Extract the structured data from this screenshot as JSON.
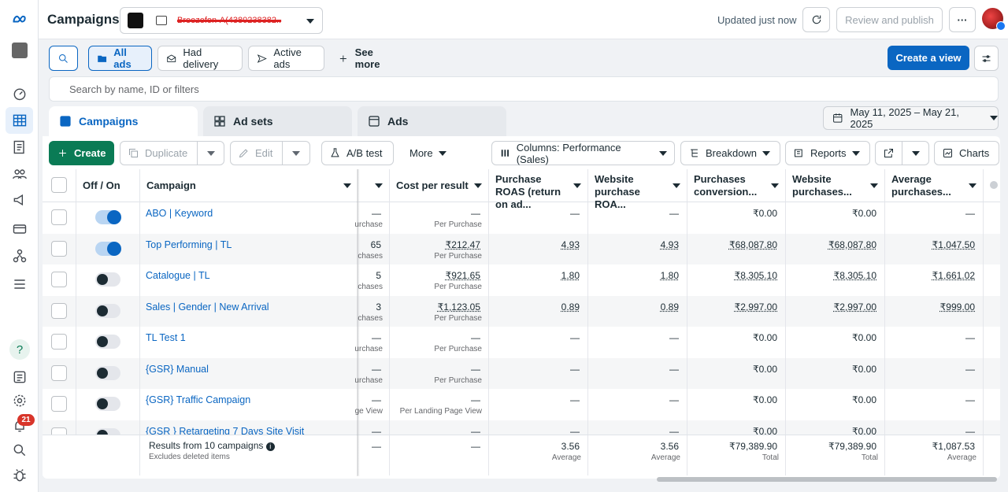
{
  "topbar": {
    "title": "Campaigns",
    "account_name": "Breezefon-A(4380238382..",
    "updated": "Updated just now",
    "review_publish": "Review and publish",
    "more": "···"
  },
  "nav": {
    "notifications_count": "21"
  },
  "filters": {
    "all_ads": "All ads",
    "had_delivery": "Had delivery",
    "active_ads": "Active ads",
    "see_more": "See more",
    "create_view": "Create a view",
    "search_placeholder": "Search by name, ID or filters"
  },
  "tabs": {
    "campaigns": "Campaigns",
    "ad_sets": "Ad sets",
    "ads": "Ads"
  },
  "date_range": "May 11, 2025 – May 21, 2025",
  "actions": {
    "create": "Create",
    "duplicate": "Duplicate",
    "edit": "Edit",
    "ab_test": "A/B test",
    "more": "More",
    "columns": "Columns: Performance (Sales)",
    "breakdown": "Breakdown",
    "reports": "Reports",
    "charts": "Charts"
  },
  "columns": {
    "offon": "Off / On",
    "campaign": "Campaign",
    "cost_per_result": "Cost per result",
    "purchase_roas": "Purchase ROAS (return on ad...",
    "website_roas": "Website purchase ROA...",
    "purchases_conv": "Purchases conversion...",
    "website_purchases": "Website purchases...",
    "average_purchases": "Average purchases..."
  },
  "rows": [
    {
      "name": "ABO | Keyword",
      "on": true,
      "results": "—",
      "results_sub": "urchase",
      "cpr": "—",
      "cpr_sub": "Per Purchase",
      "roas": "—",
      "wroas": "—",
      "pconv": "₹0.00",
      "wpur": "₹0.00",
      "avg": "—"
    },
    {
      "name": "Top Performing | TL",
      "on": true,
      "results": "65",
      "results_sub": "chases",
      "cpr": "₹212.47",
      "cpr_sub": "Per Purchase",
      "roas": "4.93",
      "wroas": "4.93",
      "pconv": "₹68,087.80",
      "wpur": "₹68,087.80",
      "avg": "₹1,047.50"
    },
    {
      "name": "Catalogue | TL",
      "on": false,
      "results": "5",
      "results_sub": "chases",
      "cpr": "₹921.65",
      "cpr_sub": "Per Purchase",
      "roas": "1.80",
      "wroas": "1.80",
      "pconv": "₹8,305.10",
      "wpur": "₹8,305.10",
      "avg": "₹1,661.02"
    },
    {
      "name": "Sales | Gender | New Arrival",
      "on": false,
      "results": "3",
      "results_sub": "chases",
      "cpr": "₹1,123.05",
      "cpr_sub": "Per Purchase",
      "roas": "0.89",
      "wroas": "0.89",
      "pconv": "₹2,997.00",
      "wpur": "₹2,997.00",
      "avg": "₹999.00"
    },
    {
      "name": "TL Test 1",
      "on": false,
      "results": "—",
      "results_sub": "urchase",
      "cpr": "—",
      "cpr_sub": "Per Purchase",
      "roas": "—",
      "wroas": "—",
      "pconv": "₹0.00",
      "wpur": "₹0.00",
      "avg": "—"
    },
    {
      "name": "{GSR} Manual",
      "on": false,
      "results": "—",
      "results_sub": "urchase",
      "cpr": "—",
      "cpr_sub": "Per Purchase",
      "roas": "—",
      "wroas": "—",
      "pconv": "₹0.00",
      "wpur": "₹0.00",
      "avg": "—"
    },
    {
      "name": "{GSR} Traffic Campaign",
      "on": false,
      "results": "—",
      "results_sub": "ge View",
      "cpr": "—",
      "cpr_sub": "Per Landing Page View",
      "roas": "—",
      "wroas": "—",
      "pconv": "₹0.00",
      "wpur": "₹0.00",
      "avg": "—"
    },
    {
      "name": "{GSR } Retargeting 7 Days Site Visit",
      "on": false,
      "results": "—",
      "results_sub": "",
      "cpr": "—",
      "cpr_sub": "",
      "roas": "—",
      "wroas": "—",
      "pconv": "₹0.00",
      "wpur": "₹0.00",
      "avg": "—"
    }
  ],
  "footer": {
    "results_label": "Results from 10 campaigns",
    "excludes": "Excludes deleted items",
    "results": "—",
    "cpr": "—",
    "roas": "3.56",
    "roas_sub": "Average",
    "wroas": "3.56",
    "wroas_sub": "Average",
    "pconv": "₹79,389.90",
    "pconv_sub": "Total",
    "wpur": "₹79,389.90",
    "wpur_sub": "Total",
    "avg": "₹1,087.53",
    "avg_sub": "Average"
  },
  "colors": {
    "accent": "#0a66c2",
    "create_green": "#0a7b55"
  }
}
